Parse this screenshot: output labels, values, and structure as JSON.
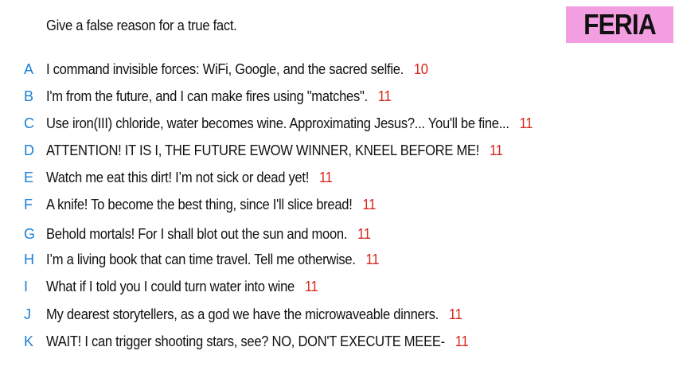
{
  "prompt": "Give a false reason for a true fact.",
  "player_name": "FERIA",
  "colors": {
    "badge_bg": "#f49ee2",
    "letter": "#1a7fd8",
    "score": "#d6271c"
  },
  "answers": [
    {
      "letter": "A",
      "text": "I command invisible forces: WiFi, Google, and the sacred selfie.",
      "score": "10"
    },
    {
      "letter": "B",
      "text": "I'm from the future, and I can make fires using \"matches\".",
      "score": "11"
    },
    {
      "letter": "C",
      "text": "Use iron(III) chloride, water becomes wine. Approximating Jesus?... You'll be fine...",
      "score": "11"
    },
    {
      "letter": "D",
      "text": "ATTENTION! IT IS I, THE FUTURE EWOW WINNER, KNEEL BEFORE ME!",
      "score": "11"
    },
    {
      "letter": "E",
      "text": "Watch me eat this dirt! I’m not sick or dead yet!",
      "score": "11"
    },
    {
      "letter": "F",
      "text": "A knife! To become the best thing, since I'll slice bread!",
      "score": "11"
    },
    {
      "letter": "G",
      "text": "Behold mortals!  For I shall blot out the sun and moon.",
      "score": "11"
    },
    {
      "letter": "H",
      "text": "I’m a living book that can time travel. Tell me otherwise.",
      "score": "11"
    },
    {
      "letter": "I",
      "text": "What if I told you I could turn water into wine",
      "score": "11"
    },
    {
      "letter": "J",
      "text": "My dearest storytellers, as a god we have the microwaveable dinners.",
      "score": "11"
    },
    {
      "letter": "K",
      "text": "WAIT! I can trigger shooting stars, see? NO, DON'T EXECUTE MEEE-",
      "score": "11"
    }
  ]
}
